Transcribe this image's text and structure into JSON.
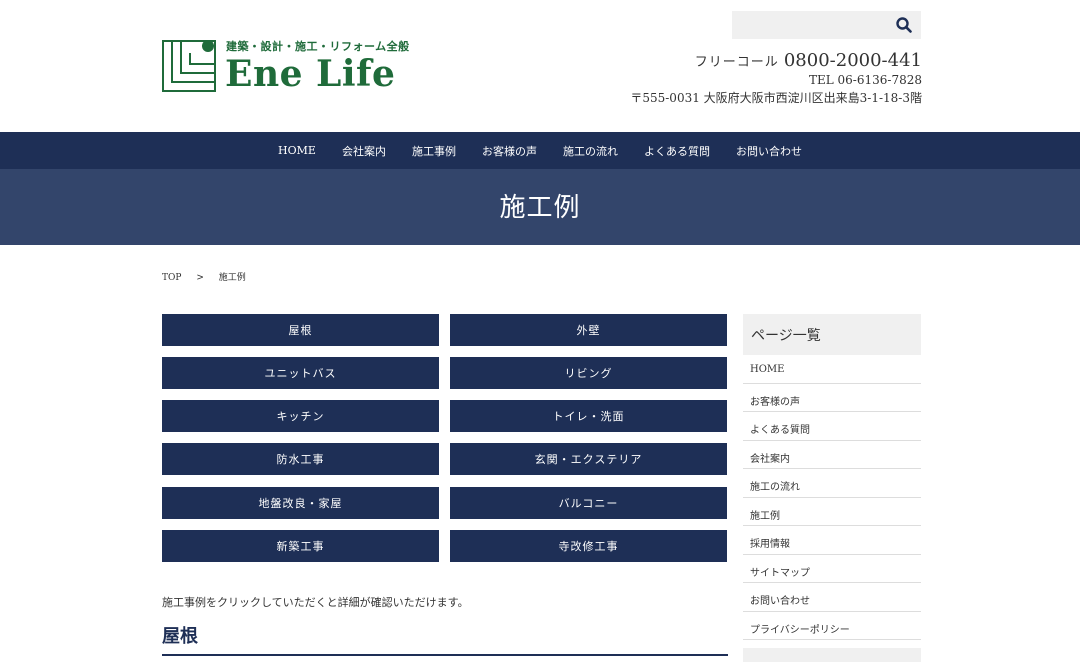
{
  "header": {
    "logo_tagline": "建築・設計・施工・リフォーム全般",
    "logo_name": "Ene Life",
    "brand_color": "#1f6b3a",
    "search_placeholder": "",
    "freecall_label": "フリーコール",
    "freecall_number": "0800-2000-441",
    "tel": "TEL 06-6136-7828",
    "address": "〒555-0031 大阪府大阪市西淀川区出来島3-1-18-3階"
  },
  "nav": {
    "color": "#1e2f56",
    "items": [
      "HOME",
      "会社案内",
      "施工事例",
      "お客様の声",
      "施工の流れ",
      "よくある質問",
      "お問い合わせ"
    ]
  },
  "banner": {
    "title": "施工例",
    "color": "#33456b"
  },
  "breadcrumb": {
    "items": [
      "TOP",
      ">",
      "施工例"
    ]
  },
  "categories": {
    "items": [
      "屋根",
      "外壁",
      "ユニットバス",
      "リビング",
      "キッチン",
      "トイレ・洗面",
      "防水工事",
      "玄関・エクステリア",
      "地盤改良・家屋",
      "バルコニー",
      "新築工事",
      "寺改修工事"
    ]
  },
  "main": {
    "intro": "施工事例をクリックしていただくと詳細が確認いただけます。",
    "section_title": "屋根"
  },
  "sidebar": {
    "heading": "ページ一覧",
    "items": [
      "HOME",
      "お客様の声",
      "よくある質問",
      "会社案内",
      "施工の流れ",
      "施工例",
      "採用情報",
      "サイトマップ",
      "お問い合わせ",
      "プライバシーポリシー"
    ]
  }
}
